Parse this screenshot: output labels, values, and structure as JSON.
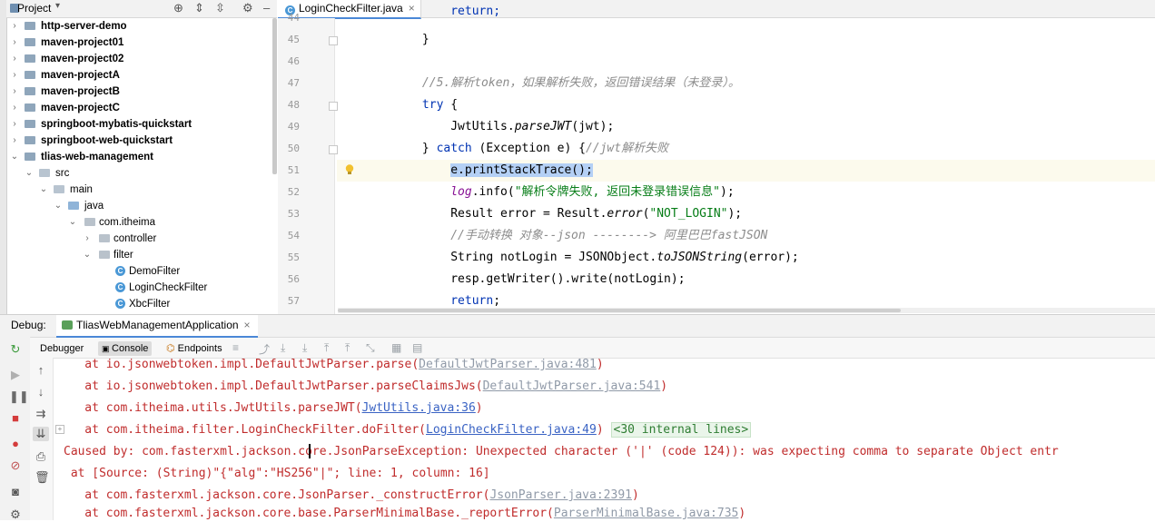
{
  "project_panel": {
    "title": "Project",
    "tree": [
      {
        "label": "http-server-demo",
        "bold": true
      },
      {
        "label": "maven-project01",
        "bold": true
      },
      {
        "label": "maven-project02",
        "bold": true
      },
      {
        "label": "maven-projectA",
        "bold": true
      },
      {
        "label": "maven-projectB",
        "bold": true
      },
      {
        "label": "maven-projectC",
        "bold": true
      },
      {
        "label": "springboot-mybatis-quickstart",
        "bold": true
      },
      {
        "label": "springboot-web-quickstart",
        "bold": true
      },
      {
        "label": "tlias-web-management",
        "bold": true
      },
      {
        "label": "src"
      },
      {
        "label": "main"
      },
      {
        "label": "java"
      },
      {
        "label": "com.itheima"
      },
      {
        "label": "controller"
      },
      {
        "label": "filter"
      },
      {
        "label": "DemoFilter"
      },
      {
        "label": "LoginCheckFilter"
      },
      {
        "label": "XbcFilter"
      }
    ]
  },
  "editor": {
    "tab_label": "LoginCheckFilter.java",
    "tab_close": "×",
    "line_numbers": [
      "44",
      "45",
      "46",
      "47",
      "48",
      "49",
      "50",
      "51",
      "52",
      "53",
      "54",
      "55",
      "56",
      "57"
    ],
    "lines": {
      "l44": "return;",
      "l45": "}",
      "l47": "//5.解析token，如果解析失败，返回错误结果（未登录）。",
      "l48_kw": "try",
      "l48_rest": " {",
      "l49_a": "JwtUtils.",
      "l49_b": "parseJWT",
      "l49_c": "(jwt);",
      "l50_a": "} ",
      "l50_kw": "catch",
      "l50_b": " (Exception e) {",
      "l50_cmt": "//jwt解析失败",
      "l51": "e.printStackTrace();",
      "l52_a": "log",
      "l52_b": ".info(",
      "l52_str": "\"解析令牌失败, 返回未登录错误信息\"",
      "l52_c": ");",
      "l53_a": "Result error = Result.",
      "l53_b": "error",
      "l53_c": "(",
      "l53_str": "\"NOT_LOGIN\"",
      "l53_d": ");",
      "l54_cmt": "//手动转换 对象--json --------> 阿里巴巴fastJSON",
      "l55_a": "String notLogin = JSONObject.",
      "l55_b": "toJSONString",
      "l55_c": "(error);",
      "l56": "resp.getWriter().write(notLogin);",
      "l57_kw": "return",
      "l57_rest": ";"
    }
  },
  "debug": {
    "label": "Debug:",
    "app_tab": "TliasWebManagementApplication",
    "app_tab_close": "×",
    "tabs": {
      "debugger": "Debugger",
      "console": "Console",
      "endpoints": "Endpoints"
    },
    "console": {
      "l1_a": "    at io.jsonwebtoken.impl.DefaultJwtParser.parse(",
      "l1_link": "DefaultJwtParser.java:481",
      "l1_b": ")",
      "l2_a": "    at io.jsonwebtoken.impl.DefaultJwtParser.parseClaimsJws(",
      "l2_link": "DefaultJwtParser.java:541",
      "l2_b": ")",
      "l3_a": "    at com.itheima.utils.JwtUtils.parseJWT(",
      "l3_link": "JwtUtils.java:36",
      "l3_b": ")",
      "l4_a": "    at com.itheima.filter.LoginCheckFilter.doFilter(",
      "l4_link": "LoginCheckFilter.java:49",
      "l4_b": ") ",
      "l4_internal": "<30 internal lines>",
      "l5": "Caused by: com.fasterxml.jackson.core.JsonParseException: Unexpected character ('|' (code 124)): was expecting comma to separate Object entr",
      "l6": " at [Source: (String)\"{\"alg\":\"HS256\"|\"; line: 1, column: 16]",
      "l7_a": "    at com.fasterxml.jackson.core.JsonParser._constructError(",
      "l7_link": "JsonParser.java:2391",
      "l7_b": ")",
      "l8_a": "    at com.fasterxml.jackson.core.base.ParserMinimalBase._reportError(",
      "l8_link": "ParserMinimalBase.java:735",
      "l8_b": ")"
    }
  }
}
